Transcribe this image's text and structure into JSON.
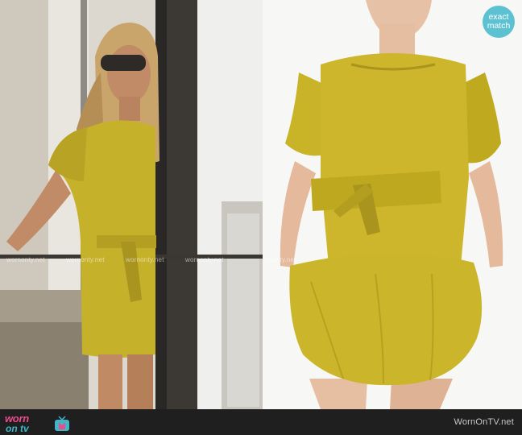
{
  "watermark": {
    "text": "wornonty.net",
    "repeat_count": 6
  },
  "badge": {
    "line1": "exact",
    "line2": "match",
    "color": "#5cc2d2"
  },
  "footer": {
    "logo_top": "worn",
    "logo_bottom": "on tv",
    "site_caption": "WornOnTV.net"
  },
  "colors": {
    "dress_mustard": "#c6b12a",
    "logo_pink": "#e84e8a",
    "logo_teal": "#3fb7c9",
    "footer_bg": "#1f1f1f"
  }
}
